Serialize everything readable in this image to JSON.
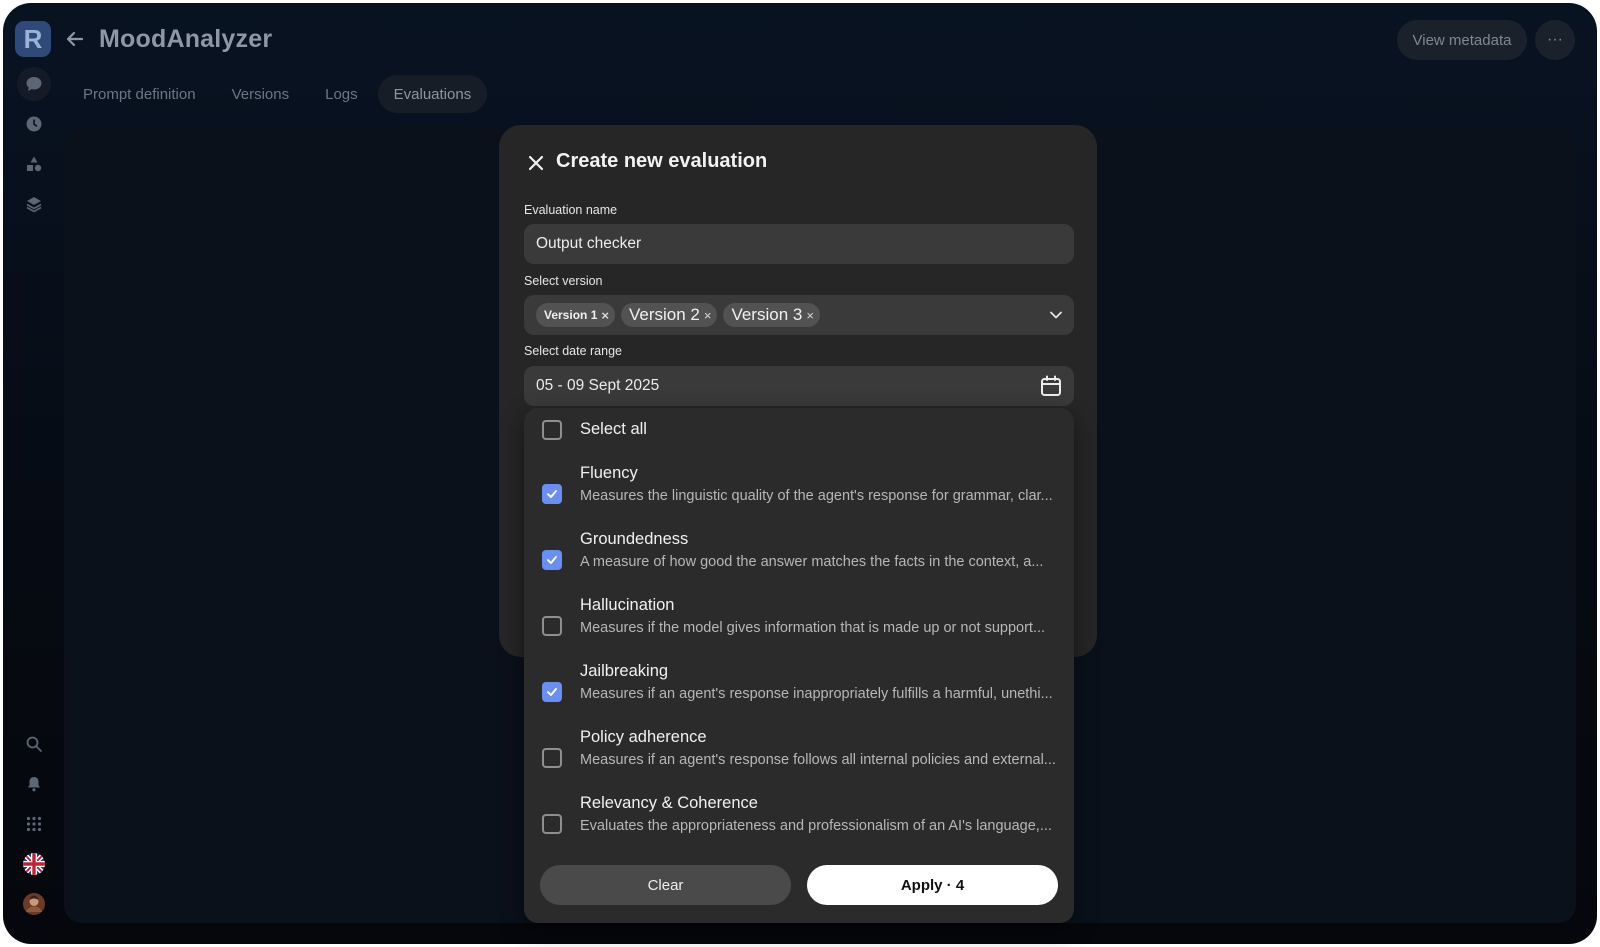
{
  "header": {
    "logo_letter": "R",
    "app_title": "MoodAnalyzer",
    "view_metadata_label": "View metadata",
    "more_label": "···"
  },
  "tabs": [
    {
      "label": "Prompt definition",
      "active": false
    },
    {
      "label": "Versions",
      "active": false
    },
    {
      "label": "Logs",
      "active": false
    },
    {
      "label": "Evaluations",
      "active": true
    }
  ],
  "sidebar": {
    "top_icons": [
      "chat-icon",
      "clock-icon",
      "shapes-icon",
      "layers-icon"
    ],
    "bottom_icons": [
      "search-icon",
      "bell-icon",
      "apps-grid-icon",
      "uk-flag-icon",
      "user-avatar"
    ]
  },
  "modal": {
    "title": "Create new evaluation",
    "name_label": "Evaluation name",
    "name_value": "Output checker",
    "version_label": "Select version",
    "versions": [
      "Version 1",
      "Version 2",
      "Version 3"
    ],
    "date_label": "Select date range",
    "date_value": "05 - 09 Sept 2025"
  },
  "dropdown": {
    "select_all_label": "Select all",
    "options": [
      {
        "title": "Fluency",
        "description": "Measures the linguistic quality of the agent's response for grammar, clar...",
        "checked": true
      },
      {
        "title": "Groundedness",
        "description": "A measure of how good the answer matches the facts in the context, a...",
        "checked": true
      },
      {
        "title": "Hallucination",
        "description": "Measures if the model gives information that is made up or not support...",
        "checked": false
      },
      {
        "title": "Jailbreaking",
        "description": "Measures if an agent's response inappropriately fulfills a harmful, unethi...",
        "checked": true
      },
      {
        "title": "Policy adherence",
        "description": "Measures if an agent's response follows all internal policies and external...",
        "checked": false
      },
      {
        "title": "Relevancy & Coherence",
        "description": "Evaluates the appropriateness and professionalism of an AI's language,...",
        "checked": false
      }
    ],
    "clear_label": "Clear",
    "apply_label": "Apply · 4"
  },
  "colors": {
    "accent_checkbox": "#6b8ff0",
    "modal_bg": "#262626",
    "app_bg": "#081322"
  }
}
